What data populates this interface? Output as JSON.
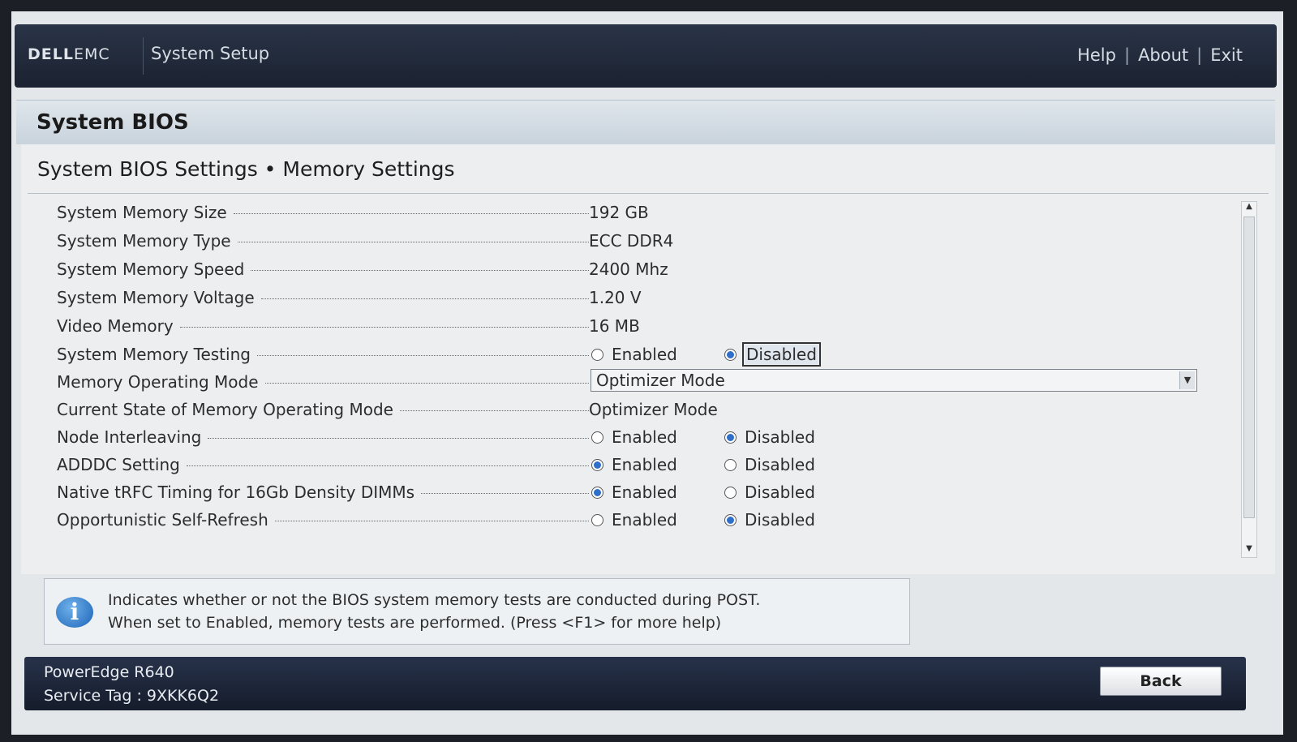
{
  "header": {
    "logo_dell": "DELL",
    "logo_emc": "EMC",
    "app_title": "System Setup",
    "links": [
      "Help",
      "About",
      "Exit"
    ],
    "link_separator": "|"
  },
  "page": {
    "title": "System BIOS",
    "subtitle": "System BIOS Settings • Memory Settings"
  },
  "settings": [
    {
      "label": "System Memory Size",
      "value": "192 GB"
    },
    {
      "label": "System Memory Type",
      "value": "ECC DDR4"
    },
    {
      "label": "System Memory Speed",
      "value": "2400 Mhz"
    },
    {
      "label": "System Memory Voltage",
      "value": "1.20 V"
    },
    {
      "label": "Video Memory",
      "value": "16 MB"
    },
    {
      "label": "System Memory Testing",
      "options": [
        "Enabled",
        "Disabled"
      ],
      "selected": "Disabled",
      "focused": true
    },
    {
      "label": "Memory Operating Mode",
      "dropdown": "Optimizer Mode"
    },
    {
      "label": "Current State of Memory Operating Mode",
      "value": "Optimizer Mode"
    },
    {
      "label": "Node Interleaving",
      "options": [
        "Enabled",
        "Disabled"
      ],
      "selected": "Disabled"
    },
    {
      "label": "ADDDC Setting",
      "options": [
        "Enabled",
        "Disabled"
      ],
      "selected": "Enabled"
    },
    {
      "label": "Native tRFC Timing for 16Gb Density DIMMs",
      "options": [
        "Enabled",
        "Disabled"
      ],
      "selected": "Enabled"
    },
    {
      "label": "Opportunistic Self-Refresh",
      "options": [
        "Enabled",
        "Disabled"
      ],
      "selected": "Disabled"
    }
  ],
  "help": {
    "line1": "Indicates whether or not the BIOS system memory tests are conducted during POST.",
    "line2": "When set to Enabled, memory tests are performed. (Press <F1> for more help)",
    "icon": "info-icon"
  },
  "footer": {
    "model": "PowerEdge R640",
    "service_tag": "Service Tag : 9XKK6Q2",
    "back_label": "Back"
  },
  "colors": {
    "header_bg": "#1b2231",
    "radio_selected": "#2f6fc9",
    "content_bg": "#eceef0"
  }
}
